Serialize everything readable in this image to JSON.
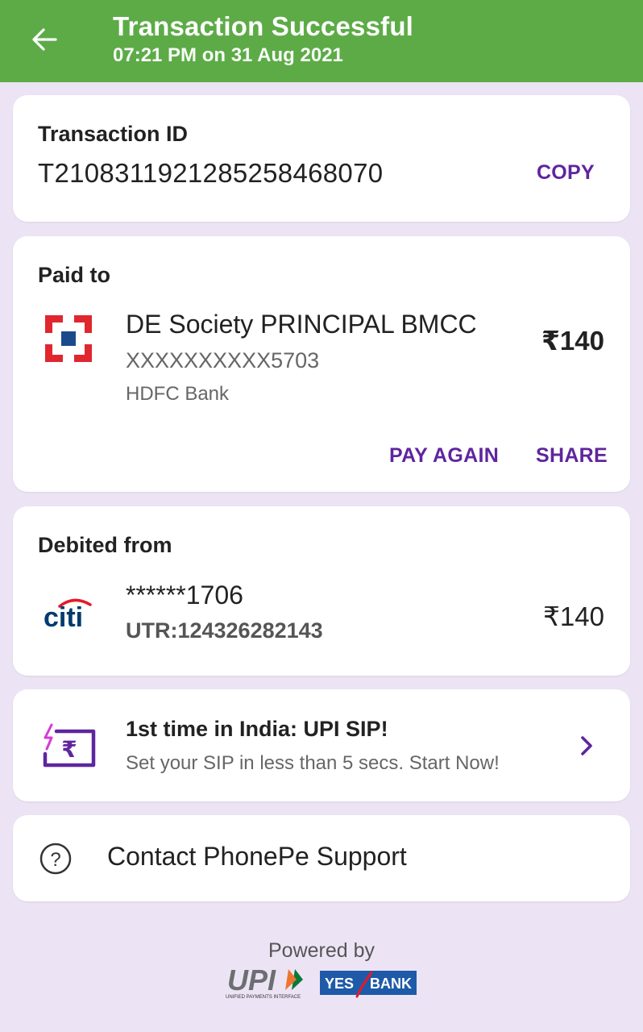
{
  "header": {
    "title": "Transaction Successful",
    "subtitle": "07:21 PM on 31 Aug 2021"
  },
  "transaction": {
    "label": "Transaction ID",
    "id": "T2108311921285258468070",
    "copy_label": "COPY"
  },
  "paid_to": {
    "label": "Paid to",
    "name": "DE Society PRINCIPAL BMCC",
    "account": "XXXXXXXXXX5703",
    "bank": "HDFC Bank",
    "amount": "₹140",
    "pay_again_label": "PAY AGAIN",
    "share_label": "SHARE"
  },
  "debited_from": {
    "label": "Debited from",
    "account": "******1706",
    "utr": "UTR:124326282143",
    "amount": "₹140",
    "bank_logo_text": "citi"
  },
  "promo": {
    "title": "1st time in India: UPI SIP!",
    "subtitle": "Set your SIP in less than 5 secs. Start Now!"
  },
  "support": {
    "label": "Contact PhonePe Support"
  },
  "footer": {
    "powered_by": "Powered by",
    "upi_logo": "UPI",
    "upi_tagline": "UNIFIED PAYMENTS INTERFACE",
    "bank_logo_left": "YES",
    "bank_logo_right": "BANK"
  },
  "colors": {
    "header_green": "#5dab47",
    "accent_purple": "#5f259f",
    "background": "#ece4f5",
    "hdfc_red": "#e0272e",
    "hdfc_blue": "#1a4a8c",
    "citi_blue": "#003b70",
    "citi_red": "#e41a2a"
  }
}
